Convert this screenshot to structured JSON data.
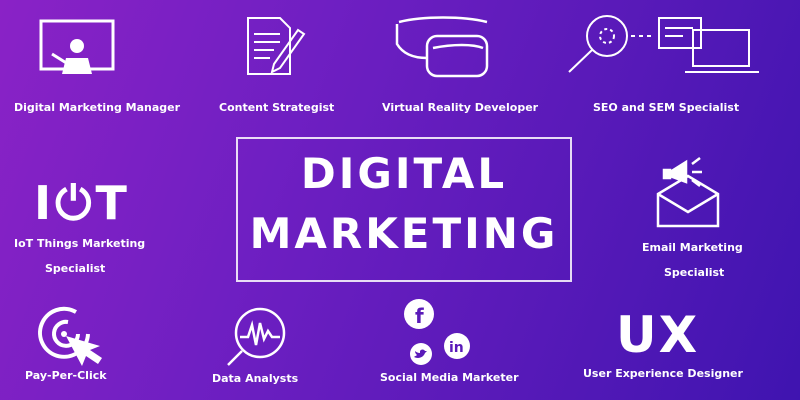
{
  "title": {
    "line1": "DIGITAL",
    "line2": "MARKETING"
  },
  "roles": {
    "digital_marketing_manager": "Digital Marketing Manager",
    "content_strategist": "Content Strategist",
    "vr_developer": "Virtual Reality Developer",
    "seo_sem_specialist": "SEO and SEM Specialist",
    "iot_line1": "IoT Things Marketing",
    "iot_line2": "Specialist",
    "email_line1": "Email Marketing",
    "email_line2": "Specialist",
    "ppc": "Pay-Per-Click",
    "data_analysts": "Data Analysts",
    "social_media": "Social Media Marketer",
    "ux_designer": "User Experience Designer"
  },
  "icon_text": {
    "iot": "I⏻T",
    "ux": "UX"
  },
  "icons": {
    "digital_marketing_manager": "presenter-screen-icon",
    "content_strategist": "document-pencil-icon",
    "vr_developer": "vr-headset-icon",
    "seo_sem_specialist": "magnifier-laptop-icon",
    "email": "megaphone-envelope-icon",
    "ppc": "target-cursor-icon",
    "data_analysts": "magnifier-chart-icon",
    "social_media": [
      "facebook-icon",
      "twitter-icon",
      "linkedin-icon"
    ]
  },
  "colors": {
    "background_start": "#8a22c6",
    "background_end": "#3f14b0",
    "foreground": "#ffffff"
  }
}
